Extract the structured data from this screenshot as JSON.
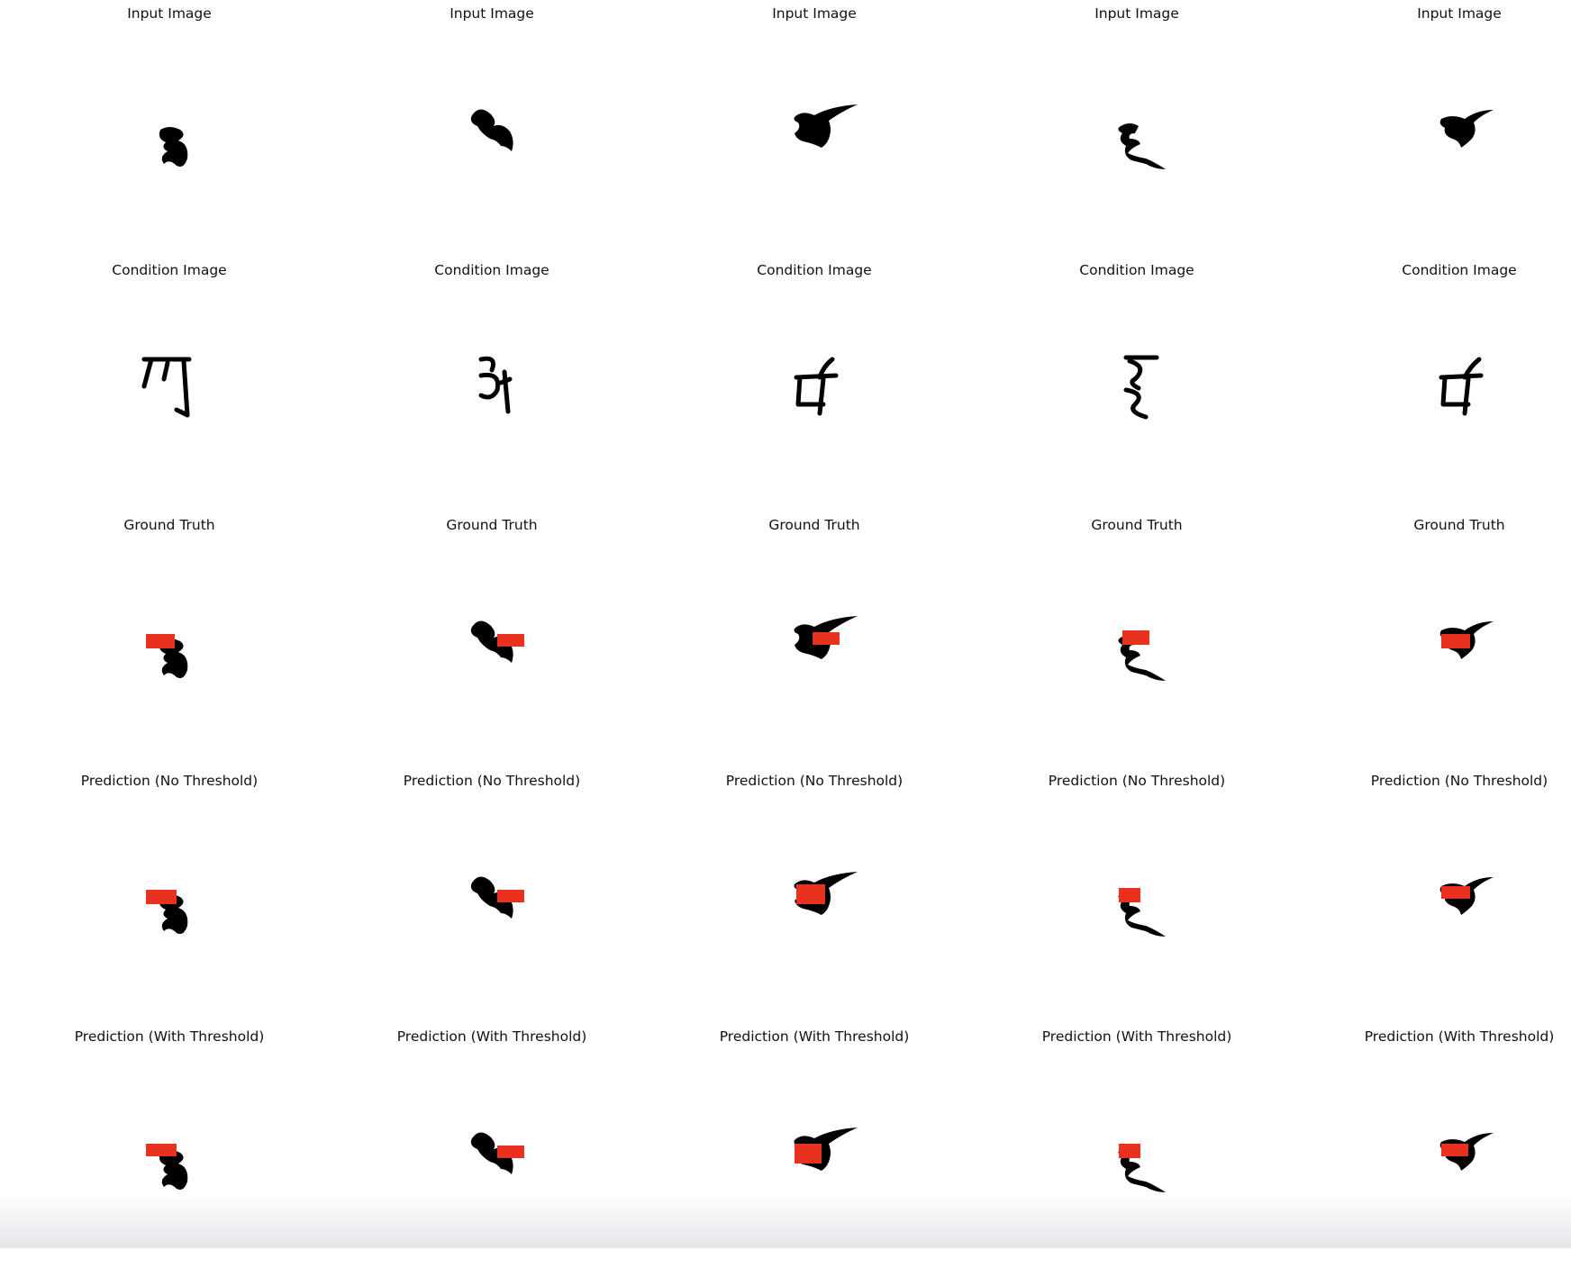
{
  "rows": [
    {
      "title": "Input Image",
      "kind": "input"
    },
    {
      "title": "Condition Image",
      "kind": "condition"
    },
    {
      "title": "Ground Truth",
      "kind": "gt"
    },
    {
      "title": "Prediction (No Threshold)",
      "kind": "pred"
    },
    {
      "title": "Prediction (With Threshold)",
      "kind": "pred_thresh"
    }
  ],
  "columns": [
    "glyph-1",
    "glyph-2",
    "glyph-3",
    "glyph-4",
    "glyph-5"
  ],
  "colors": {
    "ink": "#000000",
    "mask": "#e8321f"
  }
}
